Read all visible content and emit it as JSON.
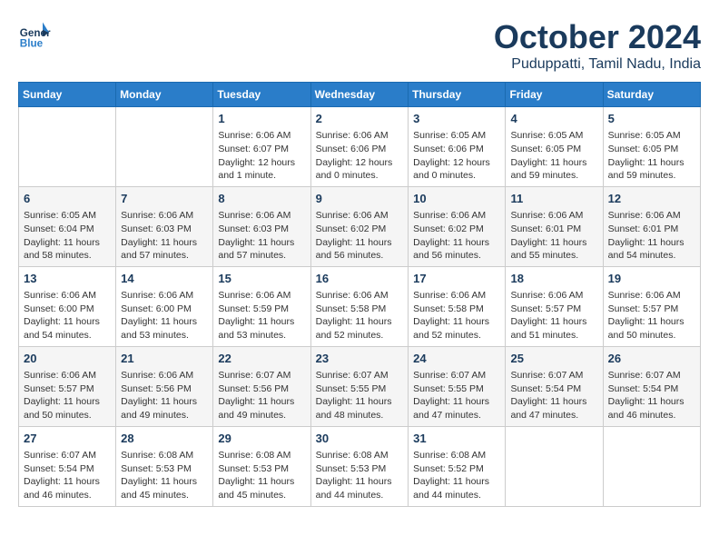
{
  "header": {
    "logo_line1": "General",
    "logo_line2": "Blue",
    "month": "October 2024",
    "location": "Puduppatti, Tamil Nadu, India"
  },
  "days_of_week": [
    "Sunday",
    "Monday",
    "Tuesday",
    "Wednesday",
    "Thursday",
    "Friday",
    "Saturday"
  ],
  "weeks": [
    [
      {
        "day": "",
        "info": ""
      },
      {
        "day": "",
        "info": ""
      },
      {
        "day": "1",
        "info": "Sunrise: 6:06 AM\nSunset: 6:07 PM\nDaylight: 12 hours\nand 1 minute."
      },
      {
        "day": "2",
        "info": "Sunrise: 6:06 AM\nSunset: 6:06 PM\nDaylight: 12 hours\nand 0 minutes."
      },
      {
        "day": "3",
        "info": "Sunrise: 6:05 AM\nSunset: 6:06 PM\nDaylight: 12 hours\nand 0 minutes."
      },
      {
        "day": "4",
        "info": "Sunrise: 6:05 AM\nSunset: 6:05 PM\nDaylight: 11 hours\nand 59 minutes."
      },
      {
        "day": "5",
        "info": "Sunrise: 6:05 AM\nSunset: 6:05 PM\nDaylight: 11 hours\nand 59 minutes."
      }
    ],
    [
      {
        "day": "6",
        "info": "Sunrise: 6:05 AM\nSunset: 6:04 PM\nDaylight: 11 hours\nand 58 minutes."
      },
      {
        "day": "7",
        "info": "Sunrise: 6:06 AM\nSunset: 6:03 PM\nDaylight: 11 hours\nand 57 minutes."
      },
      {
        "day": "8",
        "info": "Sunrise: 6:06 AM\nSunset: 6:03 PM\nDaylight: 11 hours\nand 57 minutes."
      },
      {
        "day": "9",
        "info": "Sunrise: 6:06 AM\nSunset: 6:02 PM\nDaylight: 11 hours\nand 56 minutes."
      },
      {
        "day": "10",
        "info": "Sunrise: 6:06 AM\nSunset: 6:02 PM\nDaylight: 11 hours\nand 56 minutes."
      },
      {
        "day": "11",
        "info": "Sunrise: 6:06 AM\nSunset: 6:01 PM\nDaylight: 11 hours\nand 55 minutes."
      },
      {
        "day": "12",
        "info": "Sunrise: 6:06 AM\nSunset: 6:01 PM\nDaylight: 11 hours\nand 54 minutes."
      }
    ],
    [
      {
        "day": "13",
        "info": "Sunrise: 6:06 AM\nSunset: 6:00 PM\nDaylight: 11 hours\nand 54 minutes."
      },
      {
        "day": "14",
        "info": "Sunrise: 6:06 AM\nSunset: 6:00 PM\nDaylight: 11 hours\nand 53 minutes."
      },
      {
        "day": "15",
        "info": "Sunrise: 6:06 AM\nSunset: 5:59 PM\nDaylight: 11 hours\nand 53 minutes."
      },
      {
        "day": "16",
        "info": "Sunrise: 6:06 AM\nSunset: 5:58 PM\nDaylight: 11 hours\nand 52 minutes."
      },
      {
        "day": "17",
        "info": "Sunrise: 6:06 AM\nSunset: 5:58 PM\nDaylight: 11 hours\nand 52 minutes."
      },
      {
        "day": "18",
        "info": "Sunrise: 6:06 AM\nSunset: 5:57 PM\nDaylight: 11 hours\nand 51 minutes."
      },
      {
        "day": "19",
        "info": "Sunrise: 6:06 AM\nSunset: 5:57 PM\nDaylight: 11 hours\nand 50 minutes."
      }
    ],
    [
      {
        "day": "20",
        "info": "Sunrise: 6:06 AM\nSunset: 5:57 PM\nDaylight: 11 hours\nand 50 minutes."
      },
      {
        "day": "21",
        "info": "Sunrise: 6:06 AM\nSunset: 5:56 PM\nDaylight: 11 hours\nand 49 minutes."
      },
      {
        "day": "22",
        "info": "Sunrise: 6:07 AM\nSunset: 5:56 PM\nDaylight: 11 hours\nand 49 minutes."
      },
      {
        "day": "23",
        "info": "Sunrise: 6:07 AM\nSunset: 5:55 PM\nDaylight: 11 hours\nand 48 minutes."
      },
      {
        "day": "24",
        "info": "Sunrise: 6:07 AM\nSunset: 5:55 PM\nDaylight: 11 hours\nand 47 minutes."
      },
      {
        "day": "25",
        "info": "Sunrise: 6:07 AM\nSunset: 5:54 PM\nDaylight: 11 hours\nand 47 minutes."
      },
      {
        "day": "26",
        "info": "Sunrise: 6:07 AM\nSunset: 5:54 PM\nDaylight: 11 hours\nand 46 minutes."
      }
    ],
    [
      {
        "day": "27",
        "info": "Sunrise: 6:07 AM\nSunset: 5:54 PM\nDaylight: 11 hours\nand 46 minutes."
      },
      {
        "day": "28",
        "info": "Sunrise: 6:08 AM\nSunset: 5:53 PM\nDaylight: 11 hours\nand 45 minutes."
      },
      {
        "day": "29",
        "info": "Sunrise: 6:08 AM\nSunset: 5:53 PM\nDaylight: 11 hours\nand 45 minutes."
      },
      {
        "day": "30",
        "info": "Sunrise: 6:08 AM\nSunset: 5:53 PM\nDaylight: 11 hours\nand 44 minutes."
      },
      {
        "day": "31",
        "info": "Sunrise: 6:08 AM\nSunset: 5:52 PM\nDaylight: 11 hours\nand 44 minutes."
      },
      {
        "day": "",
        "info": ""
      },
      {
        "day": "",
        "info": ""
      }
    ]
  ]
}
